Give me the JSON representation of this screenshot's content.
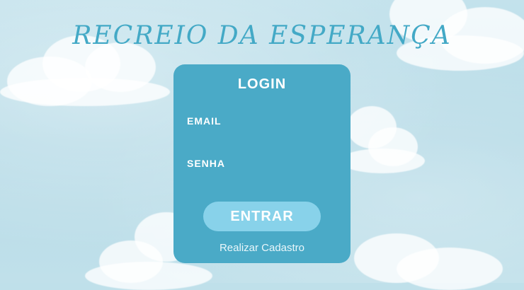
{
  "app": {
    "title": "RECREIO DA ESPERANÇA"
  },
  "login": {
    "heading": "LOGIN",
    "email_label": "EMAIL",
    "email_value": "",
    "password_label": "SENHA",
    "password_value": "",
    "submit_label": "ENTRAR",
    "register_label": "Realizar Cadastro"
  },
  "colors": {
    "sky": "#bfe0ea",
    "card": "#4aaac7",
    "title": "#43a9c6",
    "button": "#88d2ea",
    "text": "#ffffff"
  }
}
